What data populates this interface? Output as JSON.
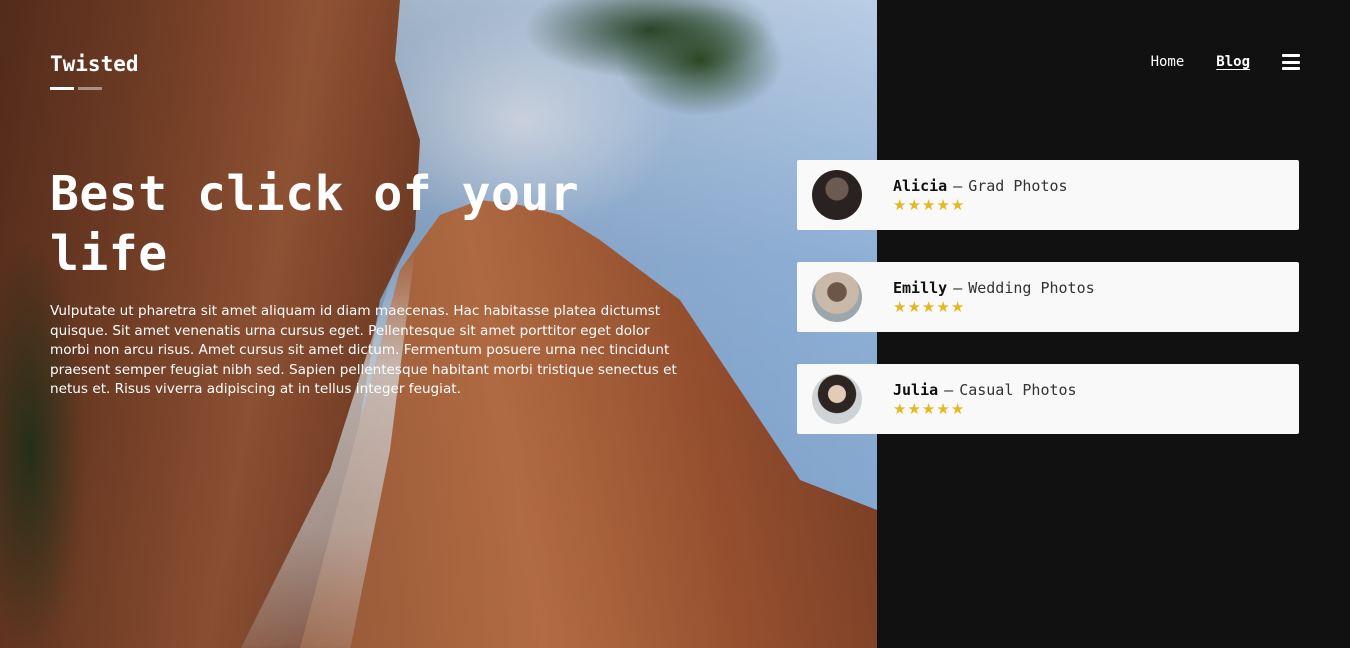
{
  "header": {
    "logo": "Twisted",
    "nav": [
      {
        "label": "Home",
        "active": false
      },
      {
        "label": "Blog",
        "active": true
      }
    ],
    "menu_icon": "hamburger-menu-icon"
  },
  "hero": {
    "title": "Best click of your life",
    "body": "Vulputate ut pharetra sit amet aliquam id diam maecenas. Hac habitasse platea dictumst quisque. Sit amet venenatis urna cursus eget. Pellentesque sit amet porttitor eget dolor morbi non arcu risus. Amet cursus sit amet dictum. Fermentum posuere urna nec tincidunt praesent semper feugiat nibh sed. Sapien pellentesque habitant morbi tristique senectus et netus et. Risus viverra adipiscing at in tellus integer feugiat."
  },
  "testimonials": [
    {
      "name": "Alicia",
      "separator": "—",
      "tag": "Grad Photos",
      "rating": 5
    },
    {
      "name": "Emilly",
      "separator": "—",
      "tag": "Wedding Photos",
      "rating": 5
    },
    {
      "name": "Julia",
      "separator": "—",
      "tag": "Casual Photos",
      "rating": 5
    }
  ],
  "colors": {
    "panel_background": "#111111",
    "card_background": "#f9f9f9",
    "star": "#e4b820"
  }
}
